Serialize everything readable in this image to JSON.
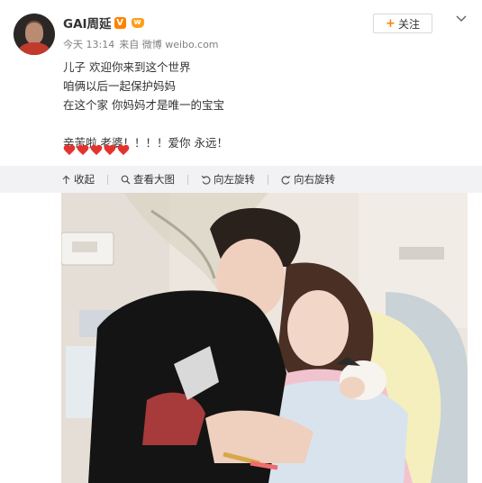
{
  "user": {
    "name": "GAI周延",
    "verify_badge": "V",
    "vip_label": "w"
  },
  "meta": {
    "time": "今天 13:14",
    "source": "来自 微博 weibo.com"
  },
  "follow_button": {
    "plus": "+",
    "label": "关注"
  },
  "post": {
    "lines": [
      "儿子 欢迎你来到这个世界",
      "咱俩以后一起保护妈妈",
      "在这个家 你妈妈才是唯一的宝宝",
      "",
      "辛苦啦 老婆！！！！爱你 永远！"
    ],
    "heart_count": 5,
    "heart_color": "#e5322d"
  },
  "toolbar": {
    "collapse_label": "收起",
    "view_large_label": "查看大图",
    "rotate_left_label": "向左旋转",
    "rotate_right_label": "向右旋转"
  },
  "colors": {
    "accent": "#ff8200",
    "toolbar_bg": "#f2f2f5",
    "meta_text": "#808080"
  }
}
